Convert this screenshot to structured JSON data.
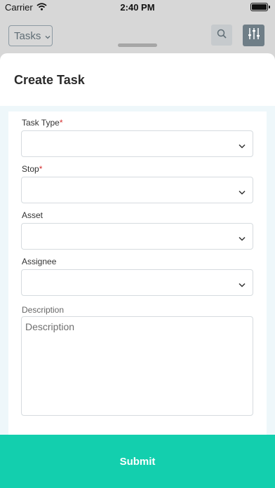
{
  "status_bar": {
    "carrier": "Carrier",
    "time": "2:40 PM"
  },
  "header": {
    "tasks_label": "Tasks"
  },
  "sheet": {
    "title": "Create Task",
    "fields": {
      "task_type": {
        "label": "Task Type",
        "required_mark": "*"
      },
      "stop": {
        "label": "Stop",
        "required_mark": "*"
      },
      "asset": {
        "label": "Asset"
      },
      "assignee": {
        "label": "Assignee"
      },
      "description": {
        "label": "Description",
        "placeholder": "Description"
      }
    },
    "submit_label": "Submit"
  },
  "colors": {
    "accent": "#13cfae",
    "required": "#d32f2f"
  },
  "icons": [
    "wifi-icon",
    "battery-icon",
    "chevron-down-icon",
    "search-icon",
    "filter-sliders-icon"
  ]
}
